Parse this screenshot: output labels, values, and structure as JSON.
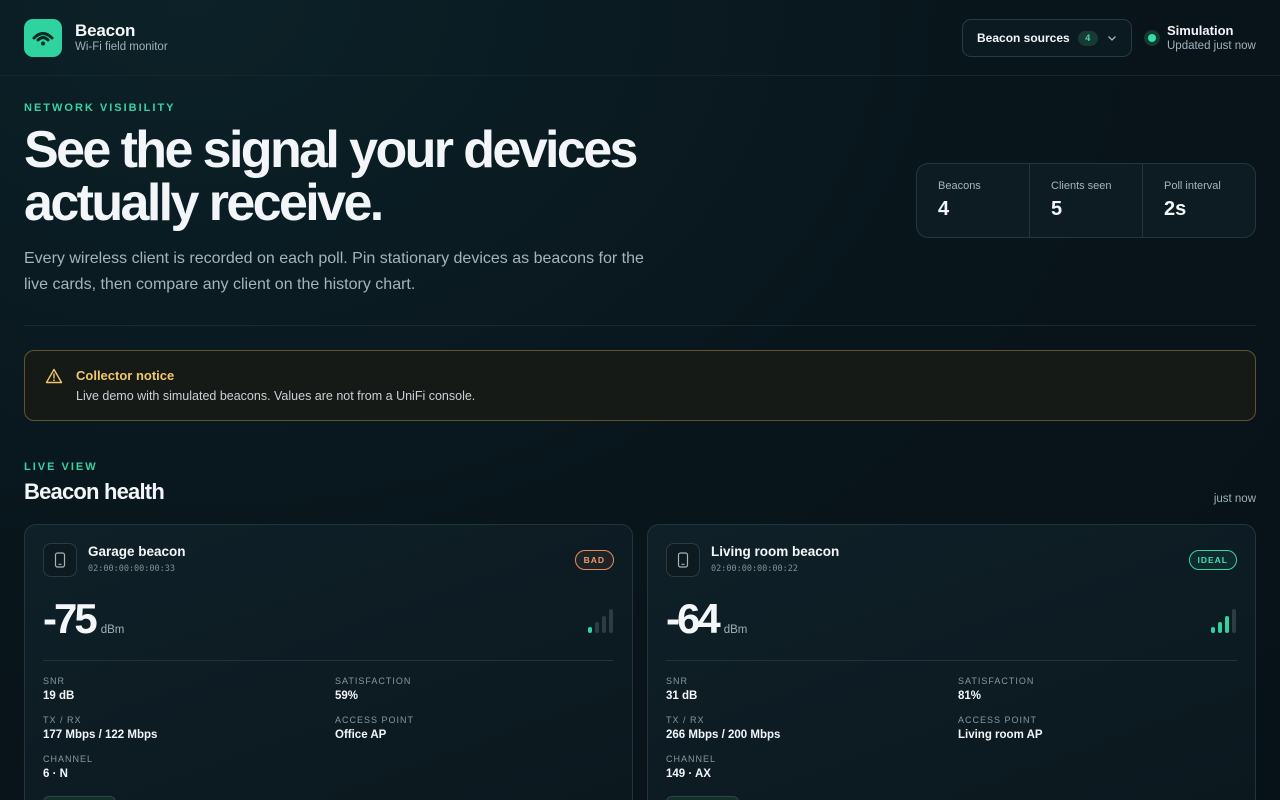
{
  "header": {
    "app_name": "Beacon",
    "app_subtitle": "Wi-Fi field monitor",
    "sources_label": "Beacon sources",
    "sources_count": "4",
    "status_title": "Simulation",
    "status_sub": "Updated just now"
  },
  "hero": {
    "eyebrow": "NETWORK VISIBILITY",
    "title_line1": "See the signal your devices",
    "title_line2": "actually receive.",
    "description": "Every wireless client is recorded on each poll. Pin stationary devices as beacons for the live cards, then compare any client on the history chart.",
    "stats": [
      {
        "label": "Beacons",
        "value": "4"
      },
      {
        "label": "Clients seen",
        "value": "5"
      },
      {
        "label": "Poll interval",
        "value": "2s"
      }
    ]
  },
  "notice": {
    "title": "Collector notice",
    "text": "Live demo with simulated beacons. Values are not from a UniFi console."
  },
  "live": {
    "eyebrow": "LIVE VIEW",
    "title": "Beacon health",
    "updated": "just now",
    "cards": [
      {
        "name": "Garage beacon",
        "mac": "02:00:00:00:00:33",
        "status": "BAD",
        "rssi": "-75",
        "unit": "dBm",
        "signal_bars": 1,
        "snr_label": "SNR",
        "snr": "19 dB",
        "sat_label": "SATISFACTION",
        "satisfaction": "59%",
        "txrx_label": "TX / RX",
        "txrx": "177 Mbps / 122 Mbps",
        "ap_label": "ACCESS POINT",
        "ap": "Office AP",
        "channel_label": "CHANNEL",
        "channel": "6 · N"
      },
      {
        "name": "Living room beacon",
        "mac": "02:00:00:00:00:22",
        "status": "IDEAL",
        "rssi": "-64",
        "unit": "dBm",
        "signal_bars": 3,
        "snr_label": "SNR",
        "snr": "31 dB",
        "sat_label": "SATISFACTION",
        "satisfaction": "81%",
        "txrx_label": "TX / RX",
        "txrx": "266 Mbps / 200 Mbps",
        "ap_label": "ACCESS POINT",
        "ap": "Living room AP",
        "channel_label": "CHANNEL",
        "channel": "149 · AX"
      }
    ]
  },
  "colors": {
    "accent": "#2fd3a0",
    "warning": "#f0c86b",
    "bad": "#f09a6a",
    "background": "#08151b"
  }
}
